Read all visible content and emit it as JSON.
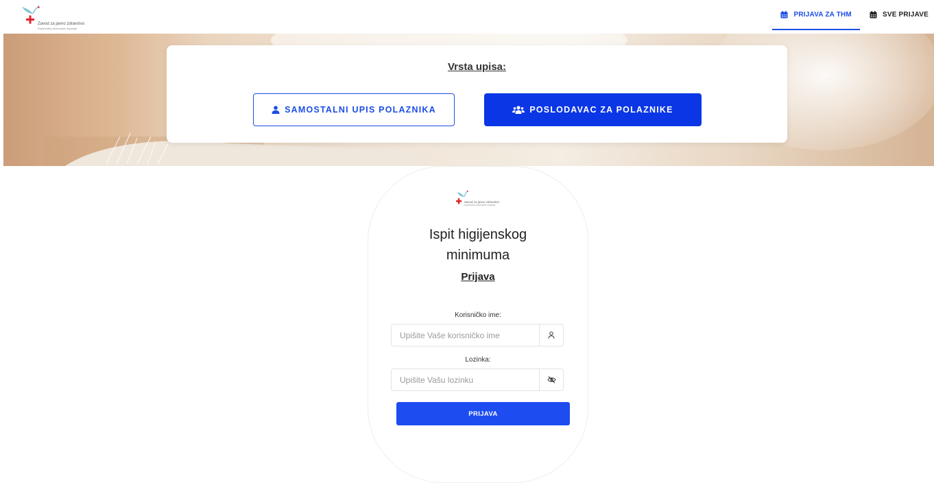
{
  "header": {
    "logo_line1": "Zavod za javno zdravstvo",
    "logo_line2": "Koprivničko-križevačke županije",
    "nav": [
      {
        "label": "PRIJAVA ZA THM",
        "active": true
      },
      {
        "label": "SVE PRIJAVE",
        "active": false
      }
    ]
  },
  "enrollment": {
    "title": "Vrsta upisa:",
    "individual_label": "SAMOSTALNI UPIS POLAZNIKA",
    "employer_label": "POSLODAVAC ZA POLAZNIKE"
  },
  "login": {
    "title": "Ispit higijenskog minimuma",
    "subtitle": "Prijava",
    "username_label": "Korisničko ime:",
    "username_placeholder": "Upišite Vaše korisničko ime",
    "password_label": "Lozinka:",
    "password_placeholder": "Upišite Vašu lozinku",
    "submit_label": "PRIJAVA"
  },
  "colors": {
    "accent": "#1b4ee6",
    "brand_red": "#e3212b",
    "logo_teal": "#6fb8c9"
  }
}
